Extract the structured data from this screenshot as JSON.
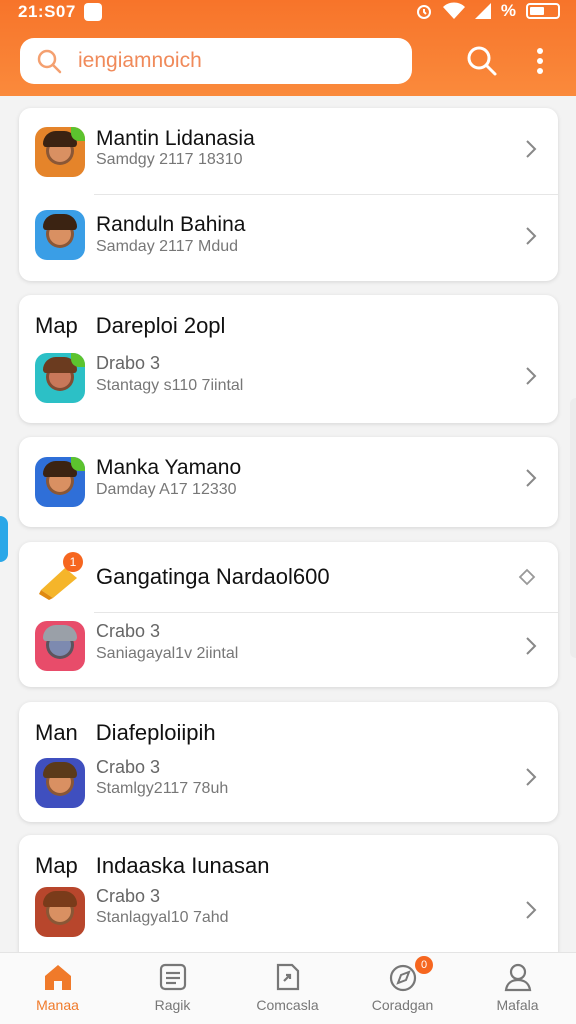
{
  "status_bar": {
    "time": "21:S07",
    "battery": "%"
  },
  "search": {
    "placeholder": "iengiamnoich"
  },
  "colors": {
    "accent": "#f7742a",
    "badge": "#f6661f",
    "scroll_hint": "#2aa7e8"
  },
  "cards": [
    {
      "section_title": "",
      "items": [
        {
          "title": "Mantin Lidanasia",
          "subtitle": "Samdgy 2117 18310",
          "icon": "hero-avatar-icon"
        },
        {
          "title": "Randuln Bahina",
          "subtitle": "Samday 2117 Mdud",
          "icon": "hero-avatar-icon"
        }
      ]
    },
    {
      "section_title_a": "Map",
      "section_title_b": "Dareploi 2opl",
      "items": [
        {
          "title": "Drabo 3",
          "subtitle": "Stantagy s110 7iintal",
          "icon": "hero-avatar-icon"
        }
      ]
    },
    {
      "items": [
        {
          "title": "Manka Yamano",
          "subtitle": "Damday A17 12330",
          "icon": "hero-avatar-icon"
        }
      ]
    },
    {
      "header_title": "Gangatinga Nardaol600",
      "header_badge": "1",
      "items": [
        {
          "title": "Crabo 3",
          "subtitle": "Saniagayal1v 2iintal",
          "icon": "hero-avatar-icon"
        }
      ]
    },
    {
      "section_title_a": "Man",
      "section_title_b": "Diafeploiipih",
      "items": [
        {
          "title": "Crabo 3",
          "subtitle": "Stamlgy2117 78uh",
          "icon": "hero-avatar-icon"
        }
      ]
    },
    {
      "section_title_a": "Map",
      "section_title_b": "Indaaska Iunasan",
      "items": [
        {
          "title": "Crabo 3",
          "subtitle": "Stanlagyal10 7ahd",
          "icon": "hero-avatar-icon"
        }
      ]
    }
  ],
  "bottom_nav": [
    {
      "label": "Manaa",
      "icon": "home-icon",
      "active": true
    },
    {
      "label": "Ragik",
      "icon": "list-icon",
      "active": false
    },
    {
      "label": "Comcasla",
      "icon": "share-icon",
      "active": false
    },
    {
      "label": "Coradgan",
      "icon": "compass-icon",
      "active": false,
      "badge": "0"
    },
    {
      "label": "Mafala",
      "icon": "profile-icon",
      "active": false
    }
  ]
}
